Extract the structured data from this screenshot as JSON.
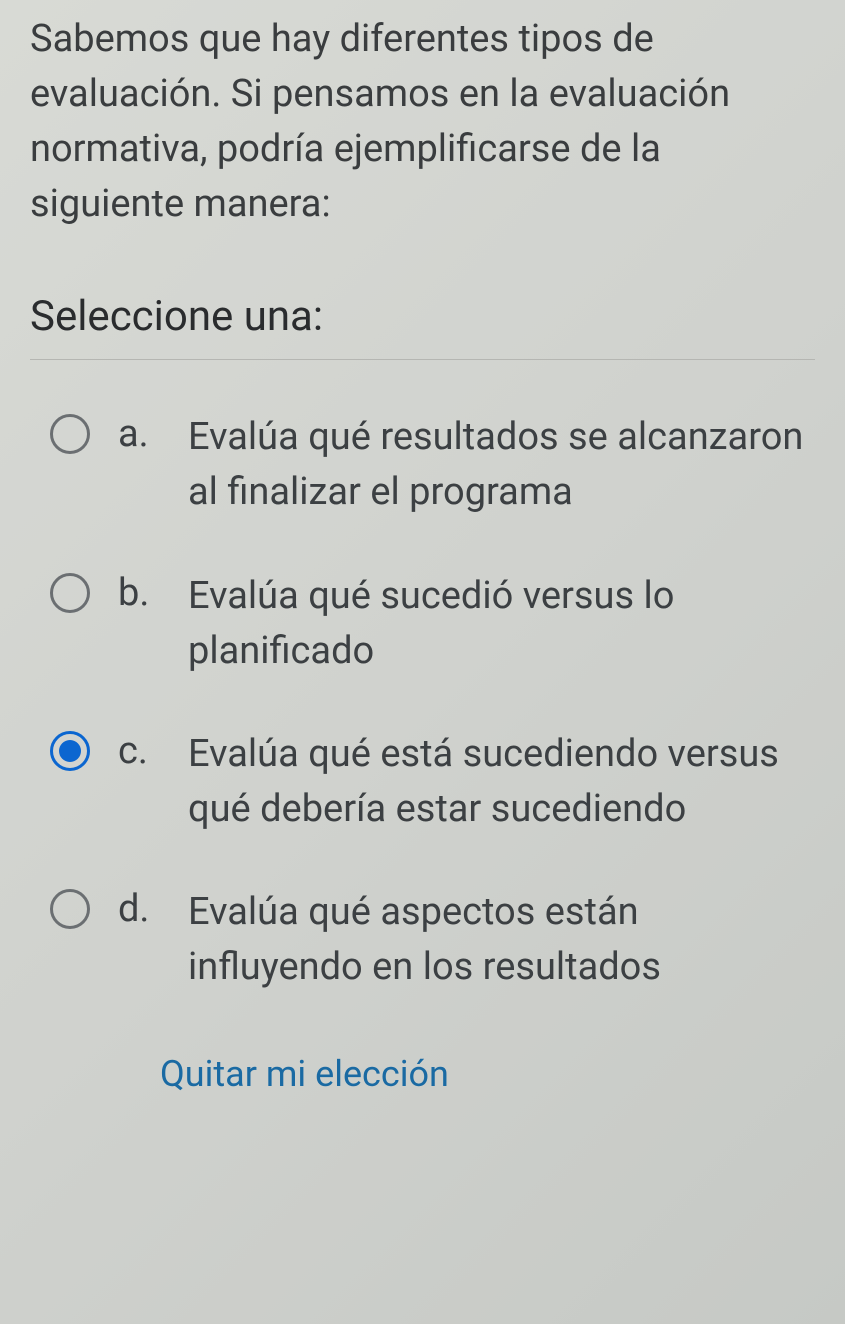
{
  "question": {
    "text": "Sabemos que hay diferentes tipos de evaluación. Si pensamos en la evaluación normativa, podría ejemplificarse de la siguiente manera:",
    "prompt": "Seleccione una:"
  },
  "options": [
    {
      "letter": "a.",
      "text": "Evalúa qué resultados se alcanzaron al finalizar el programa",
      "selected": false
    },
    {
      "letter": "b.",
      "text": "Evalúa qué sucedió versus lo planificado",
      "selected": false
    },
    {
      "letter": "c.",
      "text": "Evalúa qué está sucediendo versus qué debería estar sucediendo",
      "selected": true
    },
    {
      "letter": "d.",
      "text": "Evalúa qué aspectos están influyendo en los resultados",
      "selected": false
    }
  ],
  "actions": {
    "clear_choice": "Quitar mi elección"
  }
}
